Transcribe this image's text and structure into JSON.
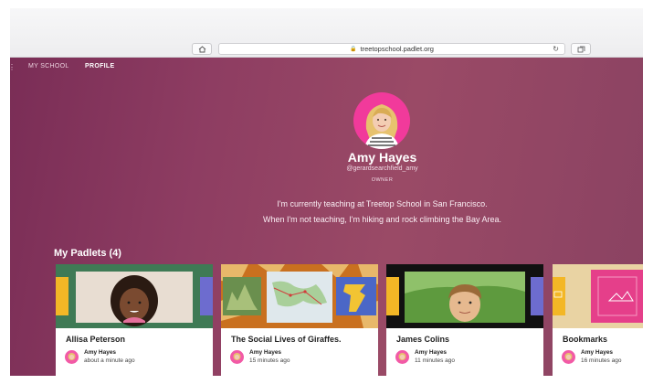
{
  "browser": {
    "url": "treetopschool.padlet.org",
    "icons": {
      "home": "home-icon",
      "lock": "lock-icon",
      "reload": "reload-icon",
      "tabs": "tabs-icon"
    }
  },
  "nav": {
    "menu_icon": "menu-icon",
    "items": [
      {
        "label": "MY SCHOOL"
      },
      {
        "label": "PROFILE"
      }
    ]
  },
  "profile": {
    "name": "Amy Hayes",
    "handle": "@gerardsearchfield_amy",
    "role": "OWNER",
    "bio_line_1": "I'm currently teaching at Treetop School in San Francisco.",
    "bio_line_2": "When I'm not teaching, I'm hiking and rock climbing the Bay Area."
  },
  "padlets": {
    "heading": "My Padlets (4)",
    "cards": [
      {
        "title": "Allisa Peterson",
        "author": "Amy Hayes",
        "time": "about a minute ago"
      },
      {
        "title": "The Social Lives of Giraffes.",
        "author": "Amy Hayes",
        "time": "15 minutes ago"
      },
      {
        "title": "James Colins",
        "author": "Amy Hayes",
        "time": "11 minutes ago"
      },
      {
        "title": "Bookmarks",
        "author": "Amy Hayes",
        "time": "16 minutes ago"
      }
    ]
  },
  "colors": {
    "page_bg": "#8e3d62",
    "avatar_bg": "#f13a9b",
    "card_bg": "#ffffff"
  }
}
